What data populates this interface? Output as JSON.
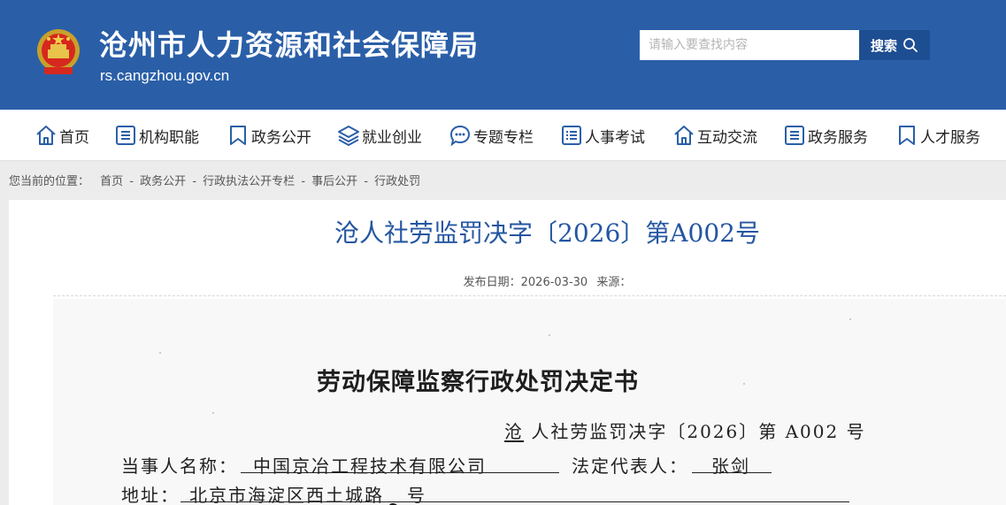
{
  "header": {
    "site_title": "沧州市人力资源和社会保障局",
    "site_url": "rs.cangzhou.gov.cn",
    "search_placeholder": "请输入要查找内容",
    "search_button_label": "搜索",
    "colors": {
      "header_bg": "#2a5fa8",
      "search_button_bg": "#1e4e92"
    }
  },
  "nav": {
    "items": [
      {
        "label": "首页",
        "icon": "home-icon"
      },
      {
        "label": "机构职能",
        "icon": "list-icon"
      },
      {
        "label": "政务公开",
        "icon": "bookmark-icon"
      },
      {
        "label": "就业创业",
        "icon": "layers-icon"
      },
      {
        "label": "专题专栏",
        "icon": "chat-bubble-icon"
      },
      {
        "label": "人事考试",
        "icon": "checklist-icon"
      },
      {
        "label": "互动交流",
        "icon": "home-icon"
      },
      {
        "label": "政务服务",
        "icon": "list-icon"
      },
      {
        "label": "人才服务",
        "icon": "bookmark-icon"
      }
    ]
  },
  "breadcrumb": {
    "prefix": "您当前的位置：",
    "items": [
      "首页",
      "政务公开",
      "行政执法公开专栏",
      "事后公开",
      "行政处罚"
    ],
    "separator": "-"
  },
  "article": {
    "title": "沧人社劳监罚决字〔2026〕第A002号",
    "meta_date_label": "发布日期：",
    "meta_date": "2026-03-30",
    "meta_source_label": "来源：",
    "title_color": "#2556a2"
  },
  "document": {
    "heading": "劳动保障监察行政处罚决定书",
    "number_prefix": "沧",
    "number_rest": "人社劳监罚决字〔2026〕第 A002 号",
    "party_label": "当事人名称：",
    "party_value": "中国京冶工程技术有限公司",
    "legal_rep_label": "法定代表人：",
    "legal_rep_value": "张剑",
    "address_label": "地址：",
    "address_value_before": "北京市海淀区西土城路",
    "address_value_after": "号"
  }
}
